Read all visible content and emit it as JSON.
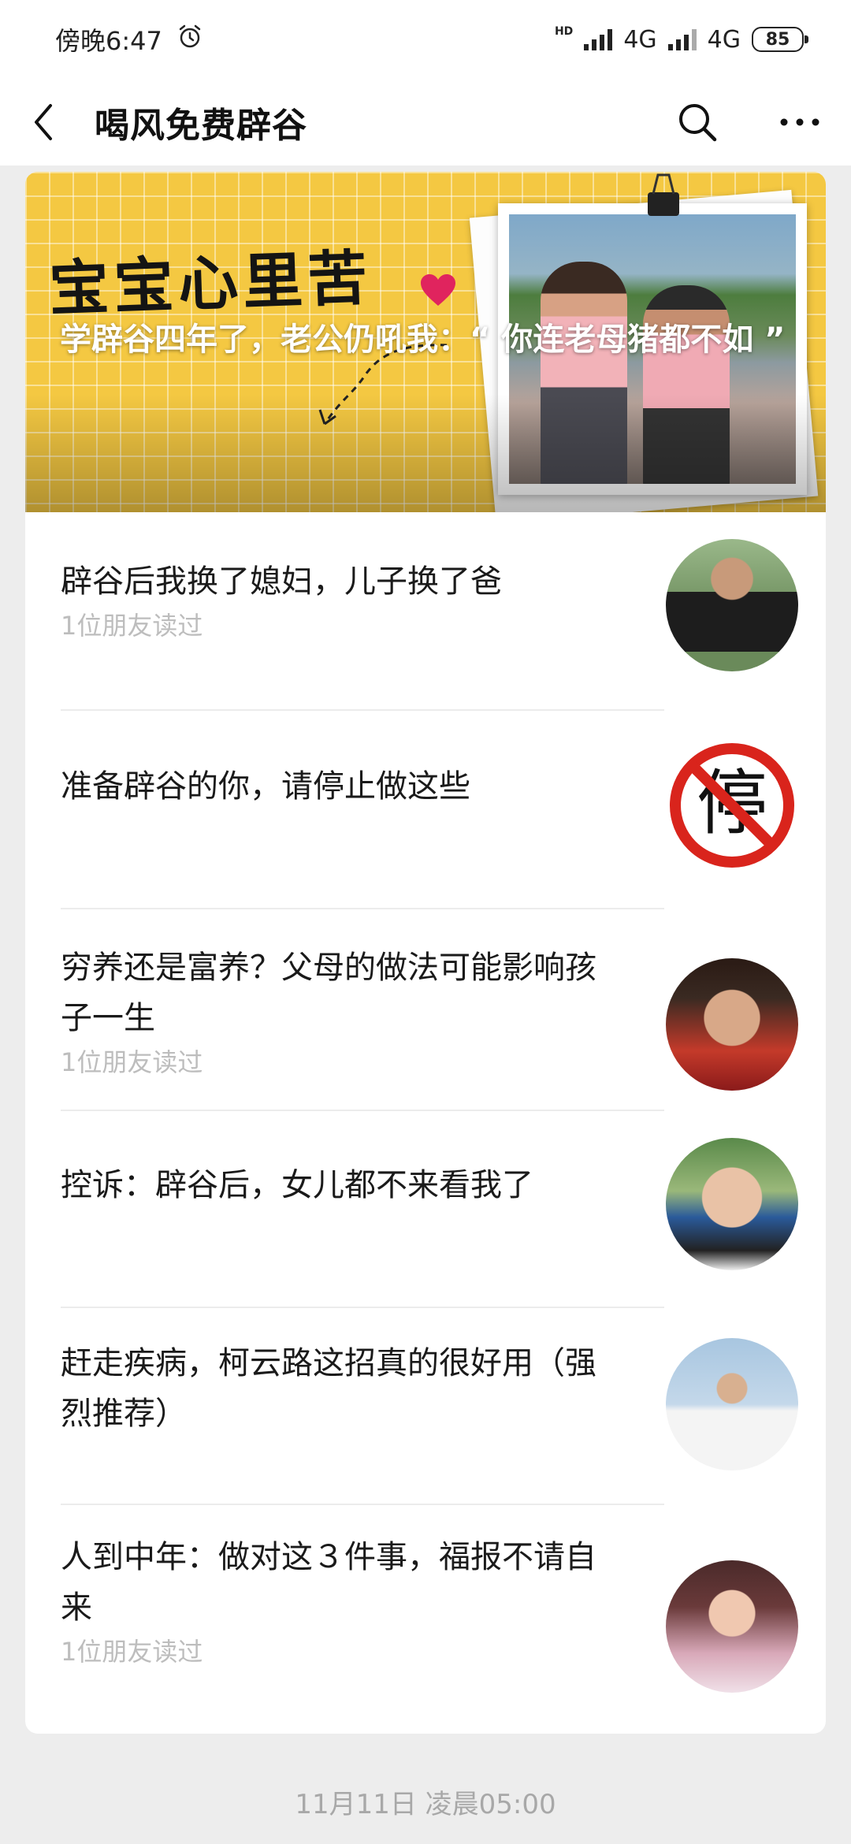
{
  "status_bar": {
    "time": "傍晚6:47",
    "network1": "4G",
    "network2": "4G",
    "hd": "HD",
    "battery": "85"
  },
  "header": {
    "title": "喝风免费辟谷"
  },
  "hero": {
    "slogan": "宝宝心里苦",
    "title": "学辟谷四年了，老公仍吼我：“ 你连老母猪都不如 ”"
  },
  "articles": [
    {
      "title": "辟谷后我换了媳妇，儿子换了爸",
      "sub": "1位朋友读过"
    },
    {
      "title": "准备辟谷的你，请停止做这些",
      "sub": "",
      "thumb_text": "停"
    },
    {
      "title": "穷养还是富养？父母的做法可能影响孩子一生",
      "sub": "1位朋友读过"
    },
    {
      "title": "控诉：辟谷后，女儿都不来看我了",
      "sub": ""
    },
    {
      "title": "赶走疾病，柯云路这招真的很好用（强烈推荐）",
      "sub": ""
    },
    {
      "title": "人到中年：做对这３件事，福报不请自来",
      "sub": "1位朋友读过"
    }
  ],
  "footer": {
    "timestamp": "11月11日 凌晨05:00"
  },
  "colors": {
    "hero_bg": "#f4c842",
    "stop_red": "#d9241c",
    "muted_text": "#bdbdbd"
  }
}
